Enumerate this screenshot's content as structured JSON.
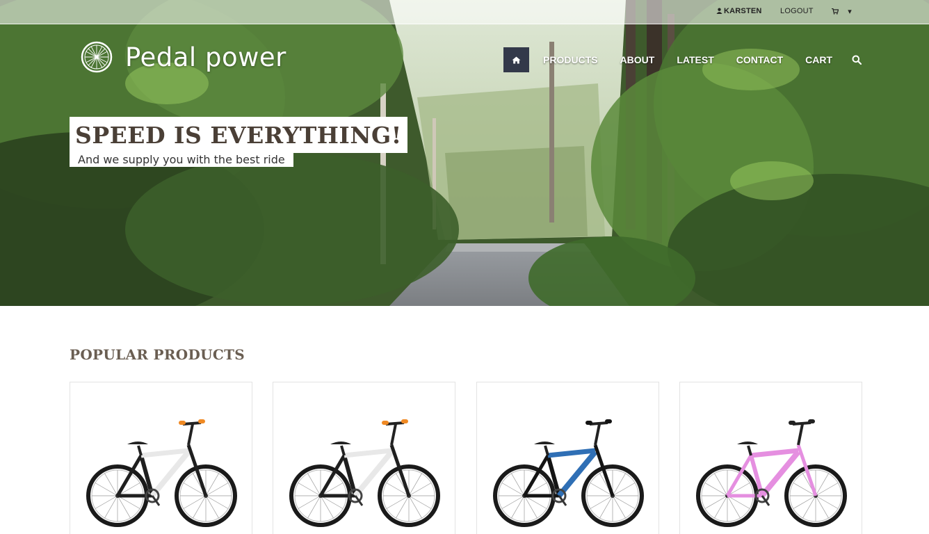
{
  "topbar": {
    "user_label": "KARSTEN",
    "logout_label": "LOGOUT",
    "cart_caret": "▾"
  },
  "brand": {
    "name": "Pedal power"
  },
  "nav": {
    "items": [
      {
        "label": "PRODUCTS"
      },
      {
        "label": "ABOUT"
      },
      {
        "label": "LATEST"
      },
      {
        "label": "CONTACT"
      },
      {
        "label": "CART"
      }
    ]
  },
  "hero": {
    "headline": "SPEED IS EVERYTHING!",
    "subline": "And we supply you with the best ride"
  },
  "section": {
    "title": "POPULAR PRODUCTS"
  },
  "products": [
    {
      "frame_color": "#1f1f1f",
      "accent": "#e8e8e8",
      "grip": "#f08a24"
    },
    {
      "frame_color": "#1f1f1f",
      "accent": "#e8e8e8",
      "grip": "#f08a24"
    },
    {
      "frame_color": "#141414",
      "accent": "#2f6fb5",
      "grip": "#141414"
    },
    {
      "frame_color": "#e58fe0",
      "accent": "#e58fe0",
      "grip": "#222222"
    }
  ],
  "colors": {
    "nav_active_bg": "#33394a",
    "headline_text": "#4a3f36",
    "section_title": "#6a5e52"
  }
}
